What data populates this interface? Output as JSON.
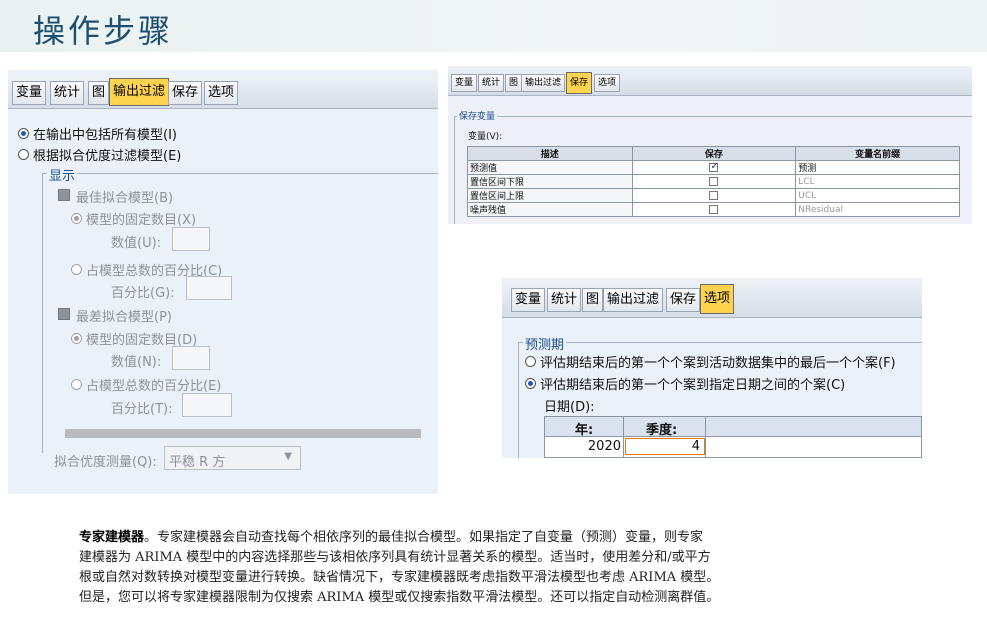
{
  "page_title": "操作步骤",
  "panel_a": {
    "tabs": [
      "变量",
      "统计",
      "图",
      "输出过滤",
      "保存",
      "选项"
    ],
    "active_tab": 3,
    "radio_all_models": "在输出中包括所有模型(I)",
    "radio_filter_models": "根据拟合优度过滤模型(E)",
    "group_display": "显示",
    "best_fit": "最佳拟合模型(B)",
    "best_fixed_count": "模型的固定数目(X)",
    "best_value_label": "数值(U):",
    "best_percent": "占模型总数的百分比(C)",
    "best_percent_label": "百分比(G):",
    "worst_fit": "最差拟合模型(P)",
    "worst_fixed_count": "模型的固定数目(D)",
    "worst_value_label": "数值(N):",
    "worst_percent": "占模型总数的百分比(E)",
    "worst_percent_label": "百分比(T):",
    "goodness_label": "拟合优度测量(Q):",
    "goodness_value": "平稳 R 方"
  },
  "panel_b": {
    "tabs": [
      "变量",
      "统计",
      "图",
      "输出过滤",
      "保存",
      "选项"
    ],
    "active_tab": 4,
    "group_label": "保存变量",
    "variables_label": "变量(V):",
    "columns": [
      "描述",
      "保存",
      "变量名前缀"
    ],
    "rows": [
      {
        "desc": "预测值",
        "save": true,
        "prefix": "预测"
      },
      {
        "desc": "置信区间下限",
        "save": false,
        "prefix": "LCL"
      },
      {
        "desc": "置信区间上限",
        "save": false,
        "prefix": "UCL"
      },
      {
        "desc": "噪声残值",
        "save": false,
        "prefix": "NResidual"
      }
    ]
  },
  "panel_c": {
    "tabs": [
      "变量",
      "统计",
      "图",
      "输出过滤",
      "保存",
      "选项"
    ],
    "active_tab": 5,
    "group_label": "预测期",
    "radio_last_case": "评估期结束后的第一个个案到活动数据集中的最后一个个案(F)",
    "radio_date": "评估期结束后的第一个个案到指定日期之间的个案(C)",
    "date_label": "日期(D):",
    "col_year": "年:",
    "col_quarter": "季度:",
    "year_value": "2020",
    "quarter_value": "4"
  },
  "paragraph": {
    "lead": "专家建模器",
    "line1": "。专家建模器会自动查找每个相依序列的最佳拟合模型。如果指定了自变量（预测）变量，则专家",
    "line2": "建模器为 ARIMA 模型中的内容选择那些与该相依序列具有统计显著关系的模型。适当时，使用差分和/或平方",
    "line3": "根或自然对数转换对模型变量进行转换。缺省情况下，专家建模器既考虑指数平滑法模型也考虑 ARIMA 模型。",
    "line4": "但是，您可以将专家建模器限制为仅搜索 ARIMA 模型或仅搜索指数平滑法模型。还可以指定自动检测离群值。"
  }
}
